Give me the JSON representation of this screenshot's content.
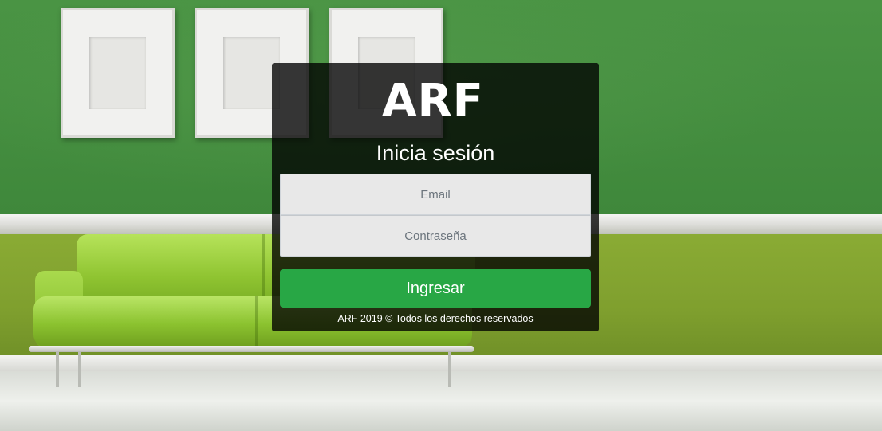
{
  "brand": {
    "logo_text": "ARF"
  },
  "login": {
    "title": "Inicia sesión",
    "email_placeholder": "Email",
    "password_placeholder": "Contraseña",
    "submit_label": "Ingresar",
    "footer": "ARF 2019 © Todos los derechos reservados"
  },
  "colors": {
    "button": "#28a745",
    "card_background": "rgba(0,0,0,0.78)",
    "input_background": "#e8e8e8"
  }
}
